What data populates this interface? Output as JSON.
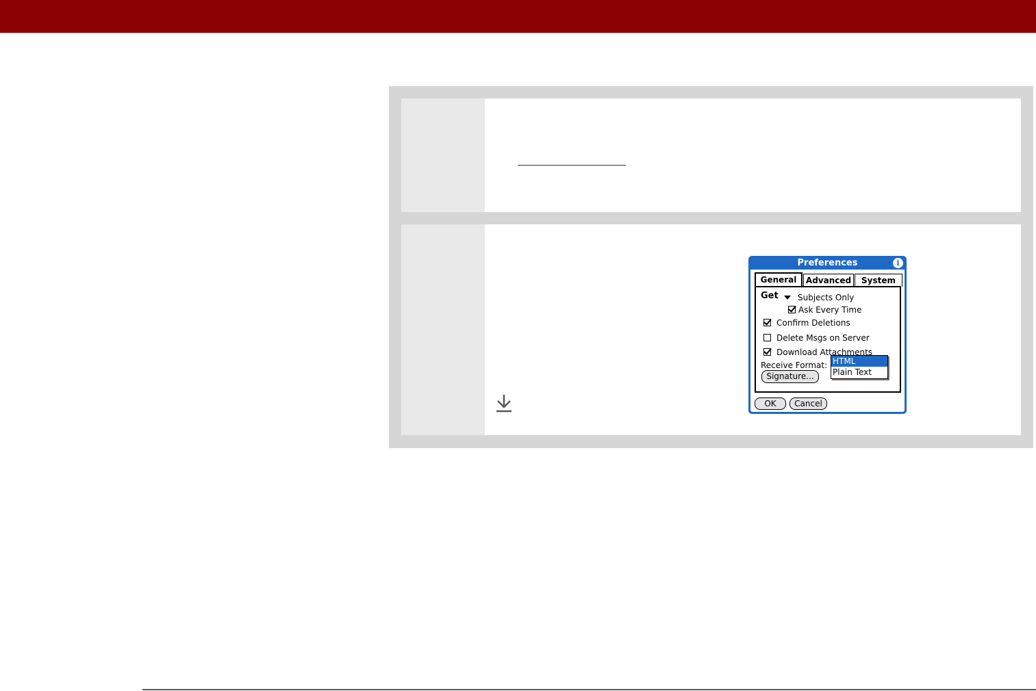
{
  "dialog": {
    "title": "Preferences",
    "info_icon": "i",
    "tabs": [
      "General",
      "Advanced",
      "System"
    ],
    "get_label": "Get",
    "get_value": "Subjects Only",
    "ask_every_time": "Ask Every Time",
    "confirm_deletions": "Confirm Deletions",
    "delete_msgs": "Delete Msgs on Server",
    "download_attachments": "Download Attachments",
    "receive_format_label": "Receive Format:",
    "receive_format_options": [
      "HTML",
      "Plain Text"
    ],
    "signature_label": "Signature...",
    "ok_label": "OK",
    "cancel_label": "Cancel"
  },
  "icons": {
    "step_arrow": "down-arrow-icon",
    "info": "info-icon",
    "dropdown": "triangle-down-icon"
  },
  "colors": {
    "header_bar": "#8b0000",
    "panel_bg": "#d6d6d6",
    "step_number_bg": "#e9e9e9",
    "palm_blue": "#1f69c4"
  }
}
